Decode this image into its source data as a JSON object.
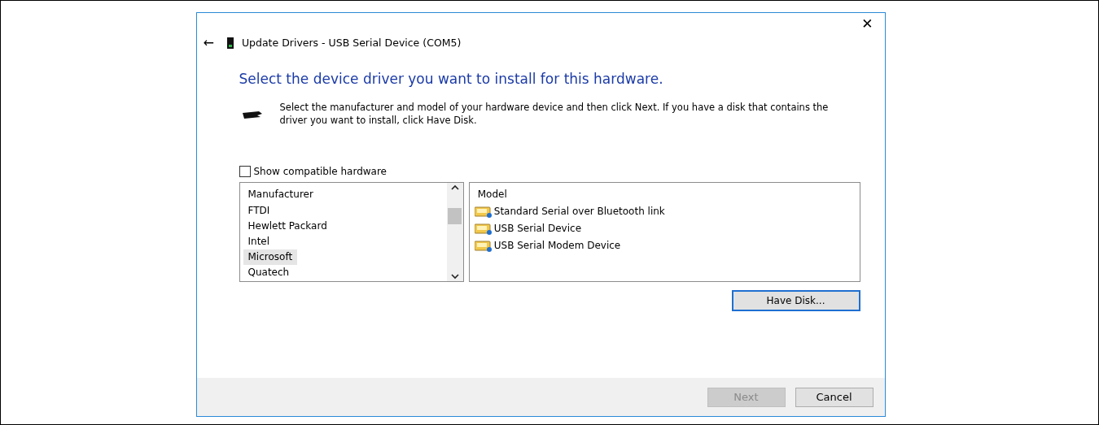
{
  "window": {
    "title": "Update Drivers - USB Serial Device (COM5)",
    "close": "✕",
    "back": "←"
  },
  "heading": "Select the device driver you want to install for this hardware.",
  "instructions": "Select the manufacturer and model of your hardware device and then click Next. If you have a disk that contains the driver you want to install, click Have Disk.",
  "show_compatible": {
    "label": "Show compatible hardware",
    "checked": false
  },
  "manufacturer_list": {
    "header": "Manufacturer",
    "items": [
      {
        "label": "FTDI",
        "selected": false
      },
      {
        "label": "Hewlett Packard",
        "selected": false
      },
      {
        "label": "Intel",
        "selected": false
      },
      {
        "label": "Microsoft",
        "selected": true
      },
      {
        "label": "Quatech",
        "selected": false
      }
    ]
  },
  "model_list": {
    "header": "Model",
    "items": [
      {
        "label": "Standard Serial over Bluetooth link",
        "selected": false
      },
      {
        "label": "USB Serial Device",
        "selected": false
      },
      {
        "label": "USB Serial Modem Device",
        "selected": false
      }
    ]
  },
  "have_disk": {
    "label": "Have Disk...",
    "focused": true
  },
  "buttons": [
    {
      "label": "Next",
      "disabled": true
    },
    {
      "label": "Cancel",
      "disabled": false
    }
  ]
}
